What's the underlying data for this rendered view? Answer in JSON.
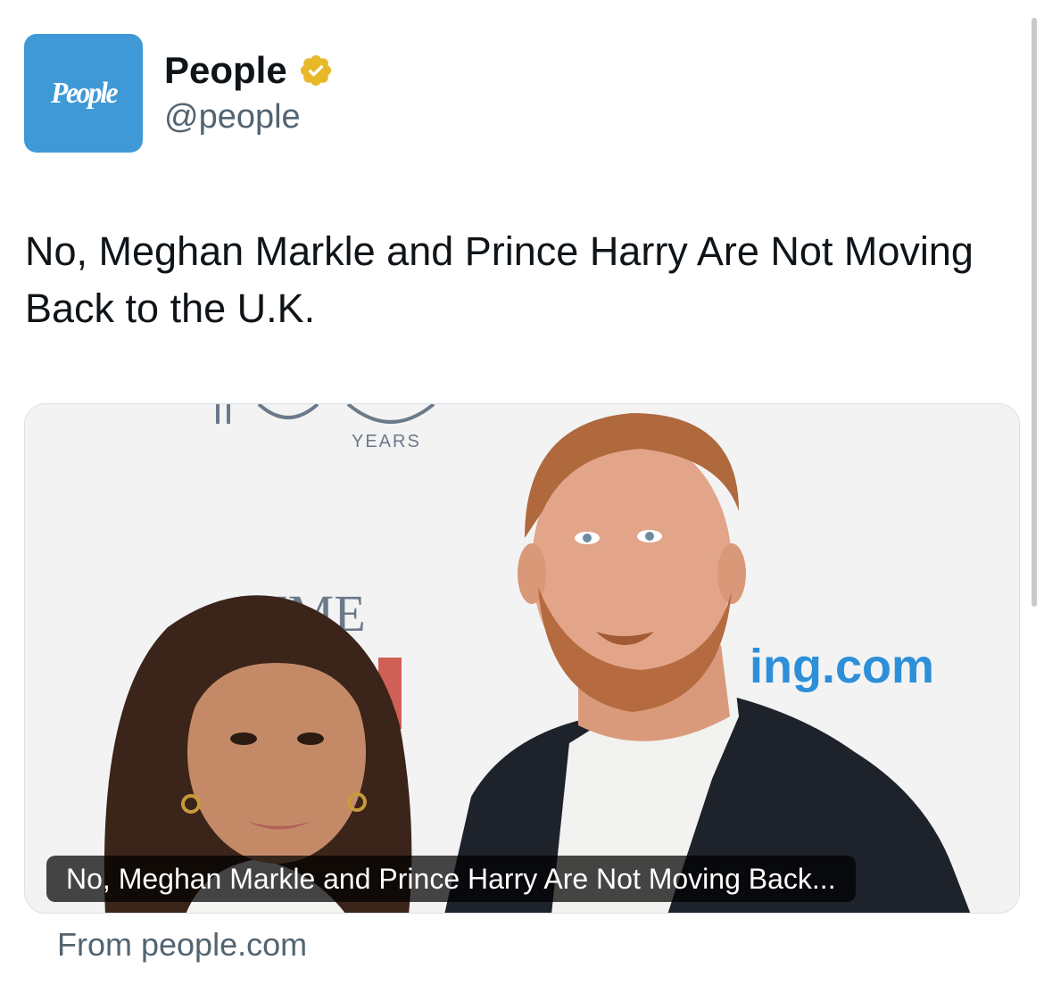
{
  "account": {
    "avatar_text": "People",
    "display_name": "People",
    "handle": "@people",
    "verified_badge_color": "#e8b829"
  },
  "tweet": {
    "text": "No, Meghan Markle and Prince Harry Are Not Moving Back to the U.K."
  },
  "card": {
    "image_description_icon": "photo",
    "backdrop_texts": {
      "years": "YEARS",
      "time": "TIME",
      "brand": "ing.com"
    },
    "title": "No, Meghan Markle and Prince Harry Are Not Moving Back...",
    "source": "From people.com"
  },
  "colors": {
    "avatar_bg": "#3f99d6",
    "handle": "#536471",
    "brand_text": "#2e8fd9"
  }
}
